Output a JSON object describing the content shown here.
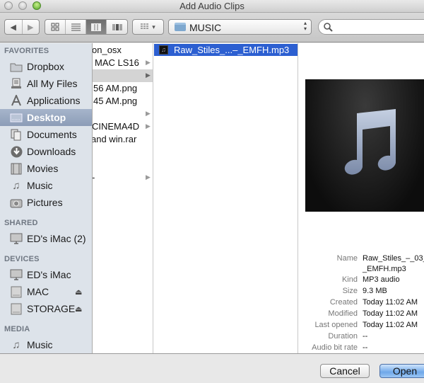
{
  "window": {
    "title": "Add Audio Clips",
    "traffic_lights": [
      "close",
      "minimize",
      "zoom"
    ]
  },
  "toolbar": {
    "nav": [
      {
        "name": "back",
        "glyph": "◀"
      },
      {
        "name": "forward",
        "glyph": "▶"
      }
    ],
    "view_modes": [
      {
        "name": "icon-view",
        "glyph": "▫▫",
        "active": false
      },
      {
        "name": "list-view",
        "glyph": "≡",
        "active": false
      },
      {
        "name": "column-view",
        "glyph": "▥",
        "active": true
      },
      {
        "name": "coverflow-view",
        "glyph": "▮",
        "active": false
      }
    ],
    "arrange_glyph": "▾",
    "location": "MUSIC",
    "location_arrows": "▴▾",
    "search": {
      "placeholder": "",
      "value": ""
    }
  },
  "sidebar": {
    "sections": [
      {
        "title": "FAVORITES",
        "items": [
          {
            "label": "Dropbox",
            "icon": "folder-icon",
            "glyph": "▭"
          },
          {
            "label": "All My Files",
            "icon": "all-files-icon",
            "glyph": "☰"
          },
          {
            "label": "Applications",
            "icon": "applications-icon",
            "glyph": "A"
          },
          {
            "label": "Desktop",
            "icon": "desktop-icon",
            "glyph": "▭",
            "selected": true
          },
          {
            "label": "Documents",
            "icon": "documents-icon",
            "glyph": "❐"
          },
          {
            "label": "Downloads",
            "icon": "downloads-icon",
            "glyph": "⬇"
          },
          {
            "label": "Movies",
            "icon": "movies-icon",
            "glyph": "▤"
          },
          {
            "label": "Music",
            "icon": "music-icon",
            "glyph": "♫"
          },
          {
            "label": "Pictures",
            "icon": "camera-icon",
            "glyph": "◉"
          }
        ]
      },
      {
        "title": "SHARED",
        "items": [
          {
            "label": "ED's iMac (2)",
            "icon": "computer-icon",
            "glyph": "▭"
          }
        ]
      },
      {
        "title": "DEVICES",
        "items": [
          {
            "label": "ED's iMac",
            "icon": "computer-icon",
            "glyph": "▭"
          },
          {
            "label": "MAC",
            "icon": "drive-icon",
            "glyph": "▢",
            "eject": "⏏"
          },
          {
            "label": "STORAGE",
            "icon": "drive-icon",
            "glyph": "▢",
            "eject": "⏏"
          }
        ]
      },
      {
        "title": "MEDIA",
        "items": [
          {
            "label": "Music",
            "icon": "music-icon",
            "glyph": "♫"
          }
        ]
      }
    ]
  },
  "column1": {
    "rows": [
      {
        "label": "on_osx",
        "arrow": false,
        "highlighted": false
      },
      {
        "label": "MAC LS16",
        "arrow": true,
        "highlighted": false
      },
      {
        "label": "",
        "arrow": true,
        "highlighted": true
      },
      {
        "label": "56 AM.png",
        "arrow": false,
        "highlighted": false
      },
      {
        "label": "45 AM.png",
        "arrow": false,
        "highlighted": false
      },
      {
        "label": "",
        "arrow": true,
        "highlighted": false
      },
      {
        "label": "CINEMA4D",
        "arrow": true,
        "highlighted": false
      },
      {
        "label": "and win.rar",
        "arrow": false,
        "highlighted": false
      },
      {
        "label": "",
        "arrow": false,
        "highlighted": false
      },
      {
        "label": "-",
        "arrow": true,
        "highlighted": false
      }
    ],
    "arrow_glyph": "▶"
  },
  "column2": {
    "selected_file": "Raw_Stiles_...–_EMFH.mp3",
    "file_icon_glyph": "♫"
  },
  "preview": {
    "info": [
      {
        "key": "Name",
        "value": "Raw_Stiles_–_03_"
      },
      {
        "key": "",
        "value": "_EMFH.mp3"
      },
      {
        "key": "Kind",
        "value": "MP3 audio"
      },
      {
        "key": "Size",
        "value": "9.3 MB"
      },
      {
        "key": "Created",
        "value": "Today 11:02 AM"
      },
      {
        "key": "Modified",
        "value": "Today 11:02 AM"
      },
      {
        "key": "Last opened",
        "value": "Today 11:02 AM"
      },
      {
        "key": "Duration",
        "value": "--"
      },
      {
        "key": "Audio bit rate",
        "value": "--"
      }
    ]
  },
  "buttons": {
    "cancel": "Cancel",
    "open": "Open"
  }
}
